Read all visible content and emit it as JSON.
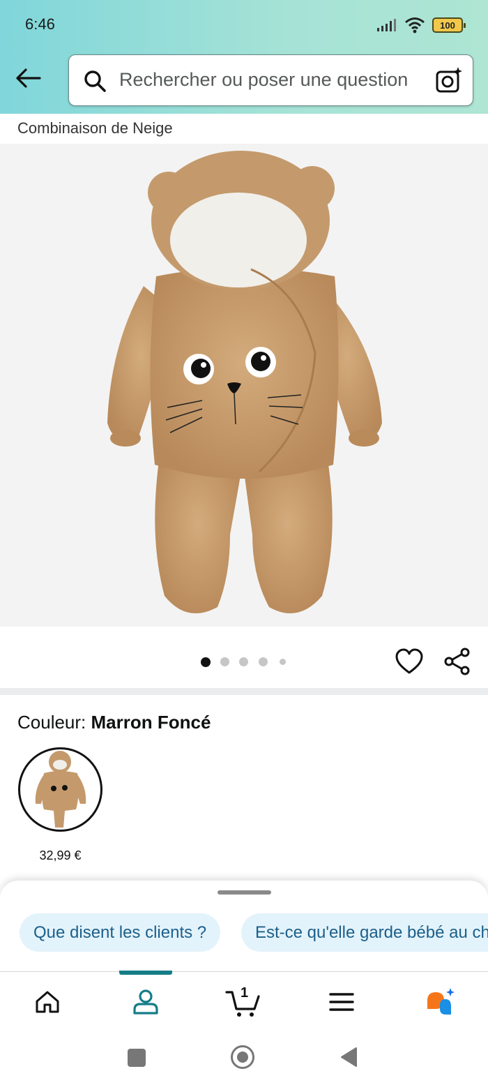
{
  "status_bar": {
    "time": "6:46",
    "battery": "100"
  },
  "search": {
    "placeholder": "Rechercher ou poser une question"
  },
  "product": {
    "title_line": "Combinaison de Neige",
    "image_count": 5,
    "active_image": 1
  },
  "color": {
    "label": "Couleur: ",
    "value": "Marron Foncé"
  },
  "variants": [
    {
      "price": "32,99 €"
    }
  ],
  "suggestions": [
    "Que disent les clients ?",
    "Est-ce qu'elle garde bébé au chaud ?"
  ],
  "nav": {
    "cart_count": "1",
    "active": "account"
  },
  "colors": {
    "accent": "#147d87",
    "chip_bg": "#e3f3fb",
    "chip_text": "#1c5f8a",
    "product": "#c49a6c"
  },
  "icons": [
    "back-arrow-icon",
    "search-icon",
    "camera-icon",
    "heart-icon",
    "share-icon",
    "home-icon",
    "account-icon",
    "cart-icon",
    "menu-icon",
    "rufus-icon"
  ]
}
